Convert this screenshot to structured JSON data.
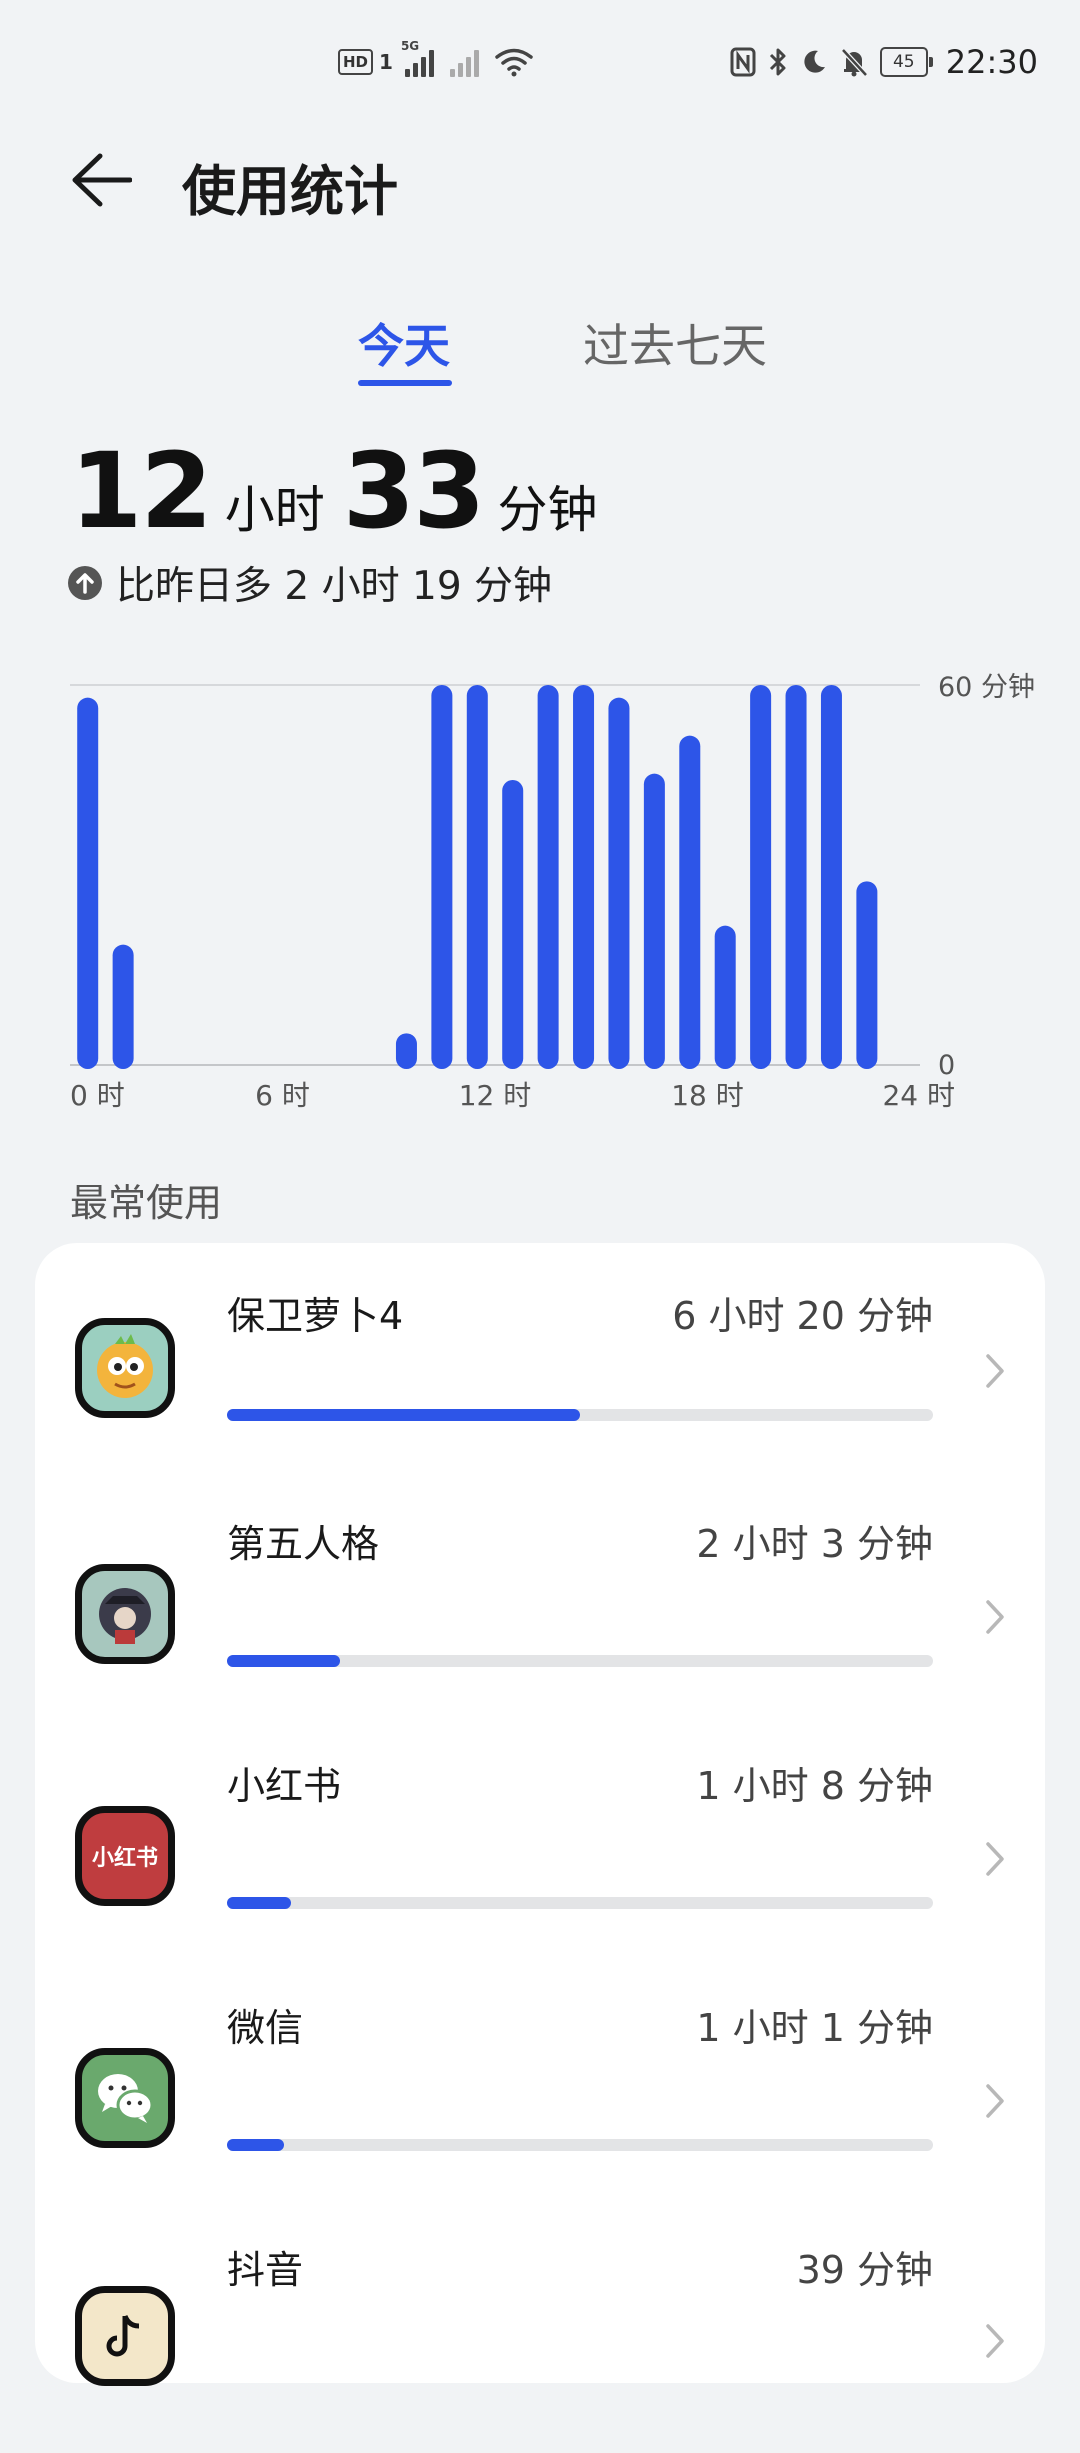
{
  "status_bar": {
    "network_hd": "HD",
    "sim_slot": "1",
    "network_type": "5G",
    "battery_level": "45",
    "time": "22:30"
  },
  "header": {
    "title": "使用统计"
  },
  "tabs": [
    {
      "label": "今天",
      "selected": true
    },
    {
      "label": "过去七天",
      "selected": false
    }
  ],
  "summary": {
    "hours": "12",
    "hours_unit": "小时",
    "minutes": "33",
    "minutes_unit": "分钟",
    "comparison": "比昨日多 2 小时 19 分钟"
  },
  "colors": {
    "accent": "#2d55e8",
    "background": "#f1f3f5",
    "card": "#ffffff"
  },
  "chart_data": {
    "type": "bar",
    "categories": [
      "0",
      "1",
      "2",
      "3",
      "4",
      "5",
      "6",
      "7",
      "8",
      "9",
      "10",
      "11",
      "12",
      "13",
      "14",
      "15",
      "16",
      "17",
      "18",
      "19",
      "20",
      "21",
      "22",
      "23"
    ],
    "values": [
      58,
      19,
      0,
      0,
      0,
      0,
      0,
      0,
      0,
      5,
      60,
      60,
      45,
      60,
      60,
      58,
      46,
      52,
      22,
      60,
      60,
      60,
      29,
      0
    ],
    "x_tick_labels": [
      "0 时",
      "6 时",
      "12 时",
      "18 时",
      "24 时"
    ],
    "y_tick_labels": [
      "60 分钟",
      "0"
    ],
    "ylim": [
      0,
      60
    ],
    "grid": true
  },
  "most_used": {
    "label": "最常使用",
    "apps": [
      {
        "name": "保卫萝卜4",
        "time": "6 小时 20 分钟",
        "share": 0.5,
        "icon": "carrot-game-icon"
      },
      {
        "name": "第五人格",
        "time": "2 小时 3 分钟",
        "share": 0.16,
        "icon": "identity-v-icon"
      },
      {
        "name": "小红书",
        "time": "1 小时 8 分钟",
        "share": 0.09,
        "icon": "xiaohongshu-icon",
        "icon_text": "小红书"
      },
      {
        "name": "微信",
        "time": "1 小时 1 分钟",
        "share": 0.08,
        "icon": "wechat-icon"
      },
      {
        "name": "抖音",
        "time": "39 分钟",
        "share": 0.05,
        "icon": "douyin-icon"
      }
    ]
  }
}
